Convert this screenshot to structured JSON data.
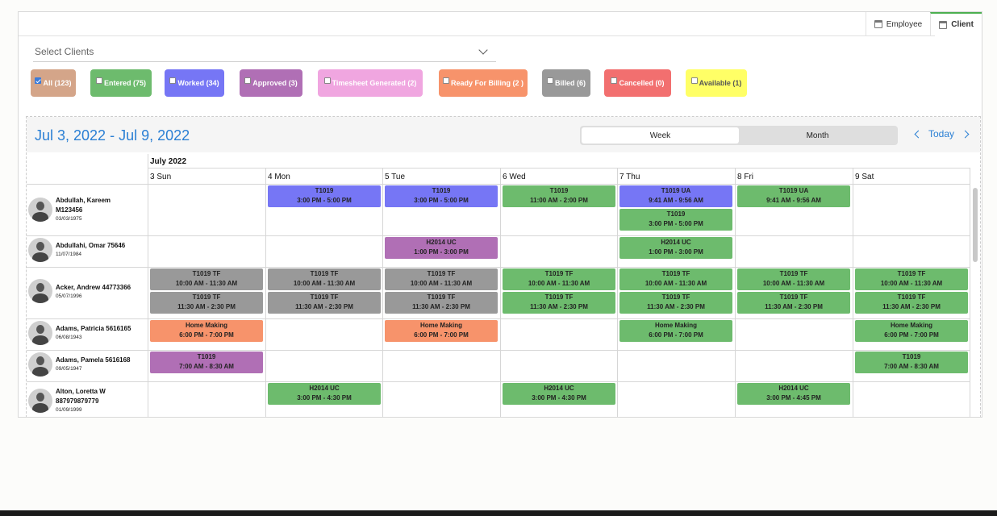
{
  "tabs": [
    {
      "label": "Employee",
      "active": false
    },
    {
      "label": "Client",
      "active": true
    }
  ],
  "select_clients": {
    "placeholder": "Select Clients"
  },
  "filters": [
    {
      "label": "All (123)",
      "checked": true,
      "color": "#d4a589"
    },
    {
      "label": "Entered (75)",
      "checked": false,
      "color": "#6dbb6d"
    },
    {
      "label": "Worked (34)",
      "checked": false,
      "color": "#7676f5"
    },
    {
      "label": "Approved (3)",
      "checked": false,
      "color": "#b06fb5"
    },
    {
      "label": "Timesheet Generated (2)",
      "checked": false,
      "color": "#f0a6e0"
    },
    {
      "label": "Ready For Billing (2 )",
      "checked": false,
      "color": "#f7936b"
    },
    {
      "label": "Billed (6)",
      "checked": false,
      "color": "#999999"
    },
    {
      "label": "Cancelled (0)",
      "checked": false,
      "color": "#f26f6f"
    },
    {
      "label": "Available (1)",
      "checked": false,
      "color": "#ffff66"
    }
  ],
  "calendar": {
    "range_title": "Jul 3, 2022 - Jul 9, 2022",
    "view_week": "Week",
    "view_month": "Month",
    "today_label": "Today",
    "month_label": "July 2022",
    "days": [
      "3 Sun",
      "4 Mon",
      "5 Tue",
      "6 Wed",
      "7 Thu",
      "8 Fri",
      "9 Sat"
    ]
  },
  "colors": {
    "worked": "#7676f5",
    "entered": "#6dbb6d",
    "approved": "#b06fb5",
    "billed": "#999999",
    "ready": "#f7936b",
    "link": "#2a7fd4"
  },
  "clients": [
    {
      "name_line1": "Abdullah, Kareem",
      "name_line2": "M123456",
      "dob": "03/03/1975"
    },
    {
      "name_line1": "Abdullahi, Omar 75646",
      "name_line2": "",
      "dob": "11/07/1984"
    },
    {
      "name_line1": "Acker, Andrew 44773366",
      "name_line2": "",
      "dob": "05/07/1996"
    },
    {
      "name_line1": "Adams, Patricia 5616165",
      "name_line2": "",
      "dob": "06/08/1943"
    },
    {
      "name_line1": "Adams, Pamela 5616168",
      "name_line2": "",
      "dob": "09/05/1947"
    },
    {
      "name_line1": "Alton, Loretta W",
      "name_line2": "887979879779",
      "dob": "01/09/1999"
    }
  ],
  "events": [
    {
      "row": 0,
      "day": 1,
      "slot": 0,
      "title": "T1019",
      "time": "3:00 PM - 5:00 PM",
      "status": "worked"
    },
    {
      "row": 0,
      "day": 2,
      "slot": 0,
      "title": "T1019",
      "time": "3:00 PM - 5:00 PM",
      "status": "worked"
    },
    {
      "row": 0,
      "day": 3,
      "slot": 0,
      "title": "T1019",
      "time": "11:00 AM - 2:00 PM",
      "status": "entered"
    },
    {
      "row": 0,
      "day": 4,
      "slot": 0,
      "title": "T1019 UA",
      "time": "9:41 AM - 9:56 AM",
      "status": "worked"
    },
    {
      "row": 0,
      "day": 4,
      "slot": 1,
      "title": "T1019",
      "time": "3:00 PM - 5:00 PM",
      "status": "entered"
    },
    {
      "row": 0,
      "day": 5,
      "slot": 0,
      "title": "T1019 UA",
      "time": "9:41 AM - 9:56 AM",
      "status": "entered"
    },
    {
      "row": 1,
      "day": 2,
      "slot": 0,
      "title": "H2014 UC",
      "time": "1:00 PM - 3:00 PM",
      "status": "approved"
    },
    {
      "row": 1,
      "day": 4,
      "slot": 0,
      "title": "H2014 UC",
      "time": "1:00 PM - 3:00 PM",
      "status": "entered"
    },
    {
      "row": 2,
      "day": 0,
      "slot": 0,
      "title": "T1019 TF",
      "time": "10:00 AM - 11:30 AM",
      "status": "billed"
    },
    {
      "row": 2,
      "day": 0,
      "slot": 1,
      "title": "T1019 TF",
      "time": "11:30 AM - 2:30 PM",
      "status": "billed"
    },
    {
      "row": 2,
      "day": 1,
      "slot": 0,
      "title": "T1019 TF",
      "time": "10:00 AM - 11:30 AM",
      "status": "billed"
    },
    {
      "row": 2,
      "day": 1,
      "slot": 1,
      "title": "T1019 TF",
      "time": "11:30 AM - 2:30 PM",
      "status": "billed"
    },
    {
      "row": 2,
      "day": 2,
      "slot": 0,
      "title": "T1019 TF",
      "time": "10:00 AM - 11:30 AM",
      "status": "billed"
    },
    {
      "row": 2,
      "day": 2,
      "slot": 1,
      "title": "T1019 TF",
      "time": "11:30 AM - 2:30 PM",
      "status": "billed"
    },
    {
      "row": 2,
      "day": 3,
      "slot": 0,
      "title": "T1019 TF",
      "time": "10:00 AM - 11:30 AM",
      "status": "entered"
    },
    {
      "row": 2,
      "day": 3,
      "slot": 1,
      "title": "T1019 TF",
      "time": "11:30 AM - 2:30 PM",
      "status": "entered"
    },
    {
      "row": 2,
      "day": 4,
      "slot": 0,
      "title": "T1019 TF",
      "time": "10:00 AM - 11:30 AM",
      "status": "entered"
    },
    {
      "row": 2,
      "day": 4,
      "slot": 1,
      "title": "T1019 TF",
      "time": "11:30 AM - 2:30 PM",
      "status": "entered"
    },
    {
      "row": 2,
      "day": 5,
      "slot": 0,
      "title": "T1019 TF",
      "time": "10:00 AM - 11:30 AM",
      "status": "entered"
    },
    {
      "row": 2,
      "day": 5,
      "slot": 1,
      "title": "T1019 TF",
      "time": "11:30 AM - 2:30 PM",
      "status": "entered"
    },
    {
      "row": 2,
      "day": 6,
      "slot": 0,
      "title": "T1019 TF",
      "time": "10:00 AM - 11:30 AM",
      "status": "entered"
    },
    {
      "row": 2,
      "day": 6,
      "slot": 1,
      "title": "T1019 TF",
      "time": "11:30 AM - 2:30 PM",
      "status": "entered"
    },
    {
      "row": 3,
      "day": 0,
      "slot": 0,
      "title": "Home Making",
      "time": "6:00 PM - 7:00 PM",
      "status": "ready"
    },
    {
      "row": 3,
      "day": 2,
      "slot": 0,
      "title": "Home Making",
      "time": "6:00 PM - 7:00 PM",
      "status": "ready"
    },
    {
      "row": 3,
      "day": 4,
      "slot": 0,
      "title": "Home Making",
      "time": "6:00 PM - 7:00 PM",
      "status": "entered"
    },
    {
      "row": 3,
      "day": 6,
      "slot": 0,
      "title": "Home Making",
      "time": "6:00 PM - 7:00 PM",
      "status": "entered"
    },
    {
      "row": 4,
      "day": 0,
      "slot": 0,
      "title": "T1019",
      "time": "7:00 AM - 8:30 AM",
      "status": "approved"
    },
    {
      "row": 4,
      "day": 6,
      "slot": 0,
      "title": "T1019",
      "time": "7:00 AM - 8:30 AM",
      "status": "entered"
    },
    {
      "row": 5,
      "day": 1,
      "slot": 0,
      "title": "H2014 UC",
      "time": "3:00 PM - 4:30 PM",
      "status": "entered"
    },
    {
      "row": 5,
      "day": 3,
      "slot": 0,
      "title": "H2014 UC",
      "time": "3:00 PM - 4:30 PM",
      "status": "entered"
    },
    {
      "row": 5,
      "day": 5,
      "slot": 0,
      "title": "H2014 UC",
      "time": "3:00 PM - 4:45 PM",
      "status": "entered"
    }
  ]
}
